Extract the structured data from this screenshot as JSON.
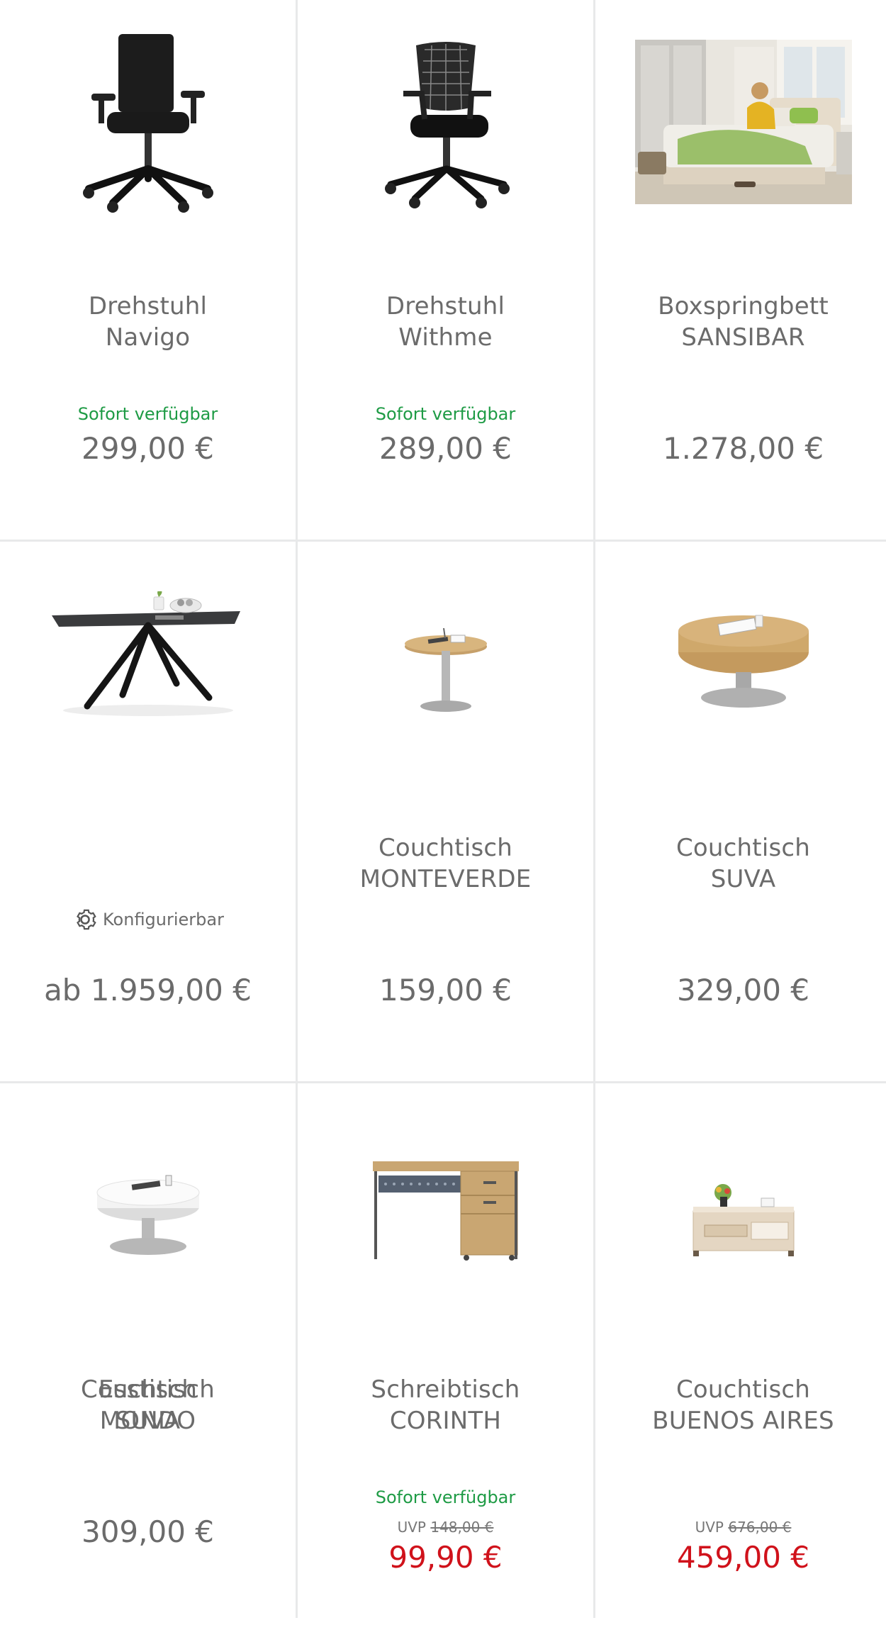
{
  "products": [
    {
      "title_line1": "Drehstuhl",
      "title_line2": "Navigo",
      "availability": "Sofort verfügbar",
      "price": "299,00 €",
      "image_icon": "office-chair-icon"
    },
    {
      "title_line1": "Drehstuhl",
      "title_line2": "Withme",
      "availability": "Sofort verfügbar",
      "price": "289,00 €",
      "image_icon": "mesh-office-chair-icon"
    },
    {
      "title_line1": "Boxspringbett",
      "title_line2": "SANSIBAR",
      "availability": "",
      "price": "1.278,00 €",
      "image_icon": "bedroom-photo-icon"
    },
    {
      "title_line1": "Esstisch",
      "title_line2": "MONDO",
      "config_label": "Konfigurierbar",
      "price": "ab 1.959,00 €",
      "image_icon": "dining-table-icon"
    },
    {
      "title_line1": "Couchtisch",
      "title_line2": "MONTEVERDE",
      "price": "159,00 €",
      "image_icon": "round-side-table-icon"
    },
    {
      "title_line1": "Couchtisch",
      "title_line2": "SUVA",
      "price": "329,00 €",
      "image_icon": "round-coffee-table-icon"
    },
    {
      "title_line1": "Couchtisch",
      "title_line2": "SUVA",
      "price": "309,00 €",
      "image_icon": "white-coffee-table-icon"
    },
    {
      "title_line1": "Schreibtisch",
      "title_line2": "CORINTH",
      "availability": "Sofort verfügbar",
      "uvp_label": "UVP",
      "uvp_price": "148,00 €",
      "price": "99,90 €",
      "image_icon": "desk-icon"
    },
    {
      "title_line1": "Couchtisch",
      "title_line2": "BUENOS AIRES",
      "uvp_label": "UVP",
      "uvp_price": "676,00 €",
      "price": "459,00 €",
      "image_icon": "wood-coffee-table-icon"
    }
  ],
  "colors": {
    "availability": "#1e9b45",
    "sale_price": "#d0121b",
    "text": "#6b6b6b",
    "divider": "#e8e9ea"
  }
}
